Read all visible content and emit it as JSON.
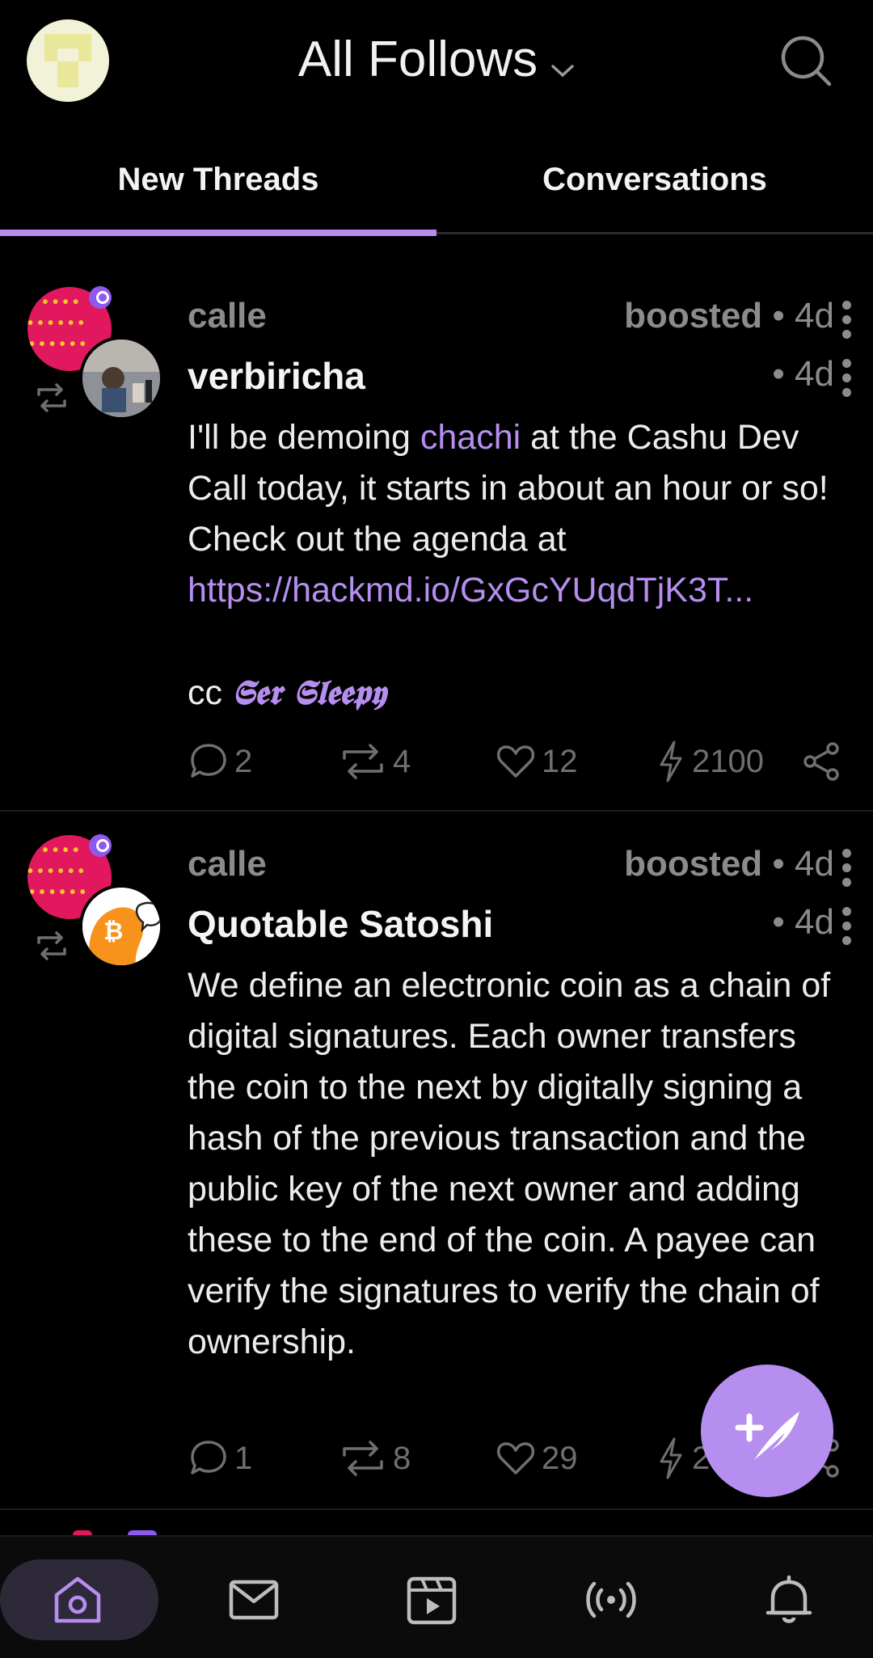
{
  "header": {
    "title": "All Follows",
    "avatar_icon": "user-avatar",
    "search_icon": "search-icon"
  },
  "tabs": [
    {
      "label": "New Threads",
      "active": true
    },
    {
      "label": "Conversations",
      "active": false
    }
  ],
  "posts": [
    {
      "booster": "calle",
      "boosted_label": "boosted",
      "boosted_time": "• 4d",
      "author": "verbiricha",
      "author_time": "• 4d",
      "content": {
        "before_mention": "I'll be demoing ",
        "mention": "chachi",
        "after_mention": " at the Cashu Dev Call today, it starts in about an hour or so! Check out the agenda at",
        "url": "https://hackmd.io/GxGcYUqdTjK3T...",
        "cc_label": "cc",
        "cc_mention": "𝕾𝖊𝖗 𝕾𝖑𝖊𝖊𝖕𝖞"
      },
      "stats": {
        "replies": "2",
        "reposts": "4",
        "likes": "12",
        "zaps": "2100"
      }
    },
    {
      "booster": "calle",
      "boosted_label": "boosted",
      "boosted_time": "• 4d",
      "author": "Quotable Satoshi",
      "author_time": "• 4d",
      "content": {
        "text": "We define an electronic coin as a chain of digital signatures. Each owner transfers the coin to the next by digitally signing a hash of the previous transaction and the public key of the next owner and adding these to the end of the coin. A payee can verify the signatures to verify the chain of ownership."
      },
      "stats": {
        "replies": "1",
        "reposts": "8",
        "likes": "29",
        "zaps": "2"
      }
    }
  ],
  "bottom_nav": [
    {
      "icon": "home-icon",
      "active": true
    },
    {
      "icon": "mail-icon",
      "active": false
    },
    {
      "icon": "video-icon",
      "active": false
    },
    {
      "icon": "broadcast-icon",
      "active": false
    },
    {
      "icon": "bell-icon",
      "active": false
    }
  ],
  "colors": {
    "accent": "#b68ef0",
    "background": "#000000",
    "muted": "#8b8b8b"
  }
}
